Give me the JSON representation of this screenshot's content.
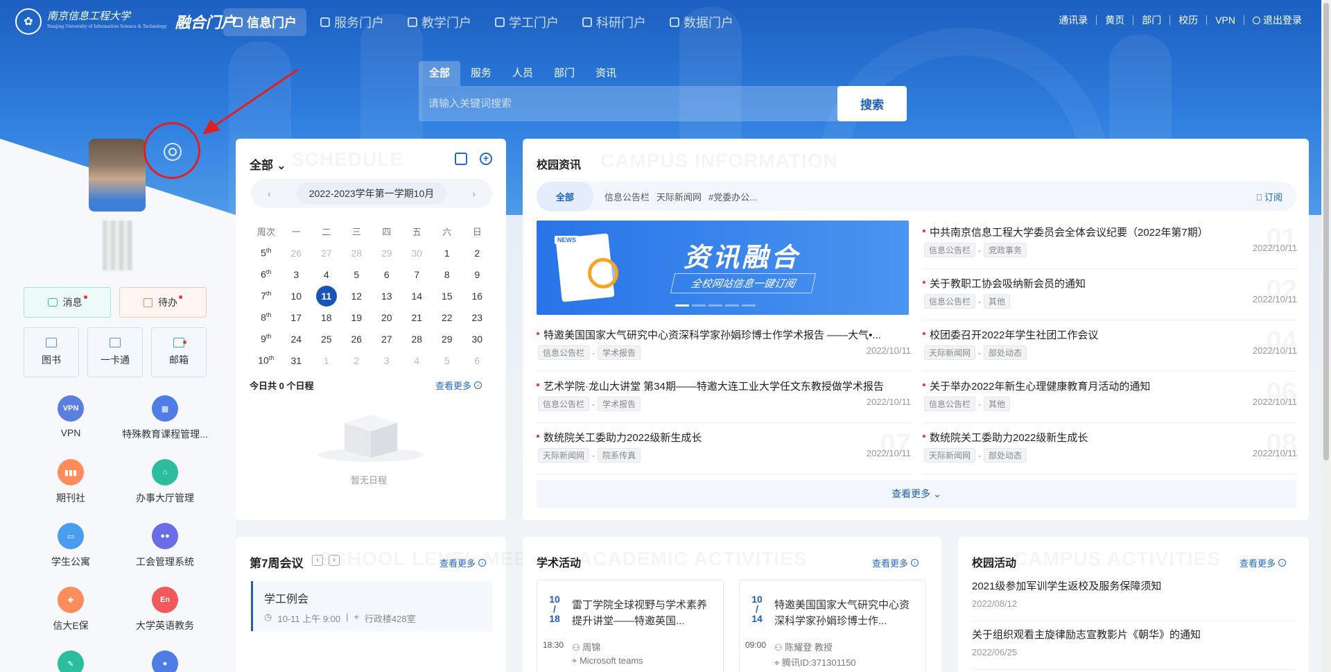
{
  "logo": {
    "school": "南京信息工程大学",
    "school_en": "Nanjing University of Information Science & Technology",
    "portal": "融合门户"
  },
  "nav": {
    "tabs": [
      "信息门户",
      "服务门户",
      "教学门户",
      "学工门户",
      "科研门户",
      "数据门户"
    ],
    "active": 0
  },
  "top_links": [
    "通讯录",
    "黄页",
    "部门",
    "校历",
    "VPN",
    "退出登录"
  ],
  "search": {
    "tabs": [
      "全部",
      "服务",
      "人员",
      "部门",
      "资讯"
    ],
    "placeholder": "请输入关键词搜索",
    "button": "搜索"
  },
  "quick": {
    "message": "消息",
    "todo": "待办",
    "library": "图书",
    "card": "一卡通",
    "mail": "邮箱"
  },
  "apps": [
    {
      "label": "VPN",
      "icon": "vpn-icon",
      "color": "#5b7fe0"
    },
    {
      "label": "特殊教育课程管理...",
      "icon": "course-icon",
      "color": "#4f7de6"
    },
    {
      "label": "期刊社",
      "icon": "books-icon",
      "color": "#ff8d5c"
    },
    {
      "label": "办事大厅管理",
      "icon": "hall-icon",
      "color": "#2bbd9e"
    },
    {
      "label": "学生公寓",
      "icon": "bed-icon",
      "color": "#4a9cf0"
    },
    {
      "label": "工会管理系统",
      "icon": "people-icon",
      "color": "#6a6ee6"
    },
    {
      "label": "信大E保",
      "icon": "bag-icon",
      "color": "#ff8d5c"
    },
    {
      "label": "大学英语教务",
      "icon": "en-icon",
      "color": "#f05a5a"
    }
  ],
  "schedule": {
    "filter": "全部",
    "watermark": "SCHEDULE",
    "month": "2022-2023学年第一学期10月",
    "weekdays": [
      "周次",
      "一",
      "二",
      "三",
      "四",
      "五",
      "六",
      "日"
    ],
    "weeks": [
      {
        "wk": "5",
        "sup": "th",
        "days": [
          [
            "26",
            1
          ],
          [
            "27",
            1
          ],
          [
            "28",
            1
          ],
          [
            "29",
            1
          ],
          [
            "30",
            1
          ],
          [
            "1",
            0
          ],
          [
            "2",
            0
          ]
        ]
      },
      {
        "wk": "6",
        "sup": "th",
        "days": [
          [
            "3",
            0
          ],
          [
            "4",
            0
          ],
          [
            "5",
            0
          ],
          [
            "6",
            0
          ],
          [
            "7",
            0
          ],
          [
            "8",
            0
          ],
          [
            "9",
            0
          ]
        ]
      },
      {
        "wk": "7",
        "sup": "th",
        "days": [
          [
            "10",
            0
          ],
          [
            "11",
            2
          ],
          [
            "12",
            0
          ],
          [
            "13",
            0
          ],
          [
            "14",
            0
          ],
          [
            "15",
            0
          ],
          [
            "16",
            0
          ]
        ]
      },
      {
        "wk": "8",
        "sup": "th",
        "days": [
          [
            "17",
            0
          ],
          [
            "18",
            0
          ],
          [
            "19",
            0
          ],
          [
            "20",
            0
          ],
          [
            "21",
            0
          ],
          [
            "22",
            0
          ],
          [
            "23",
            0
          ]
        ]
      },
      {
        "wk": "9",
        "sup": "th",
        "days": [
          [
            "24",
            0
          ],
          [
            "25",
            0
          ],
          [
            "26",
            0
          ],
          [
            "27",
            0
          ],
          [
            "28",
            0
          ],
          [
            "29",
            0
          ],
          [
            "30",
            0
          ]
        ]
      },
      {
        "wk": "10",
        "sup": "th",
        "days": [
          [
            "31",
            0
          ],
          [
            "1",
            1
          ],
          [
            "2",
            1
          ],
          [
            "3",
            1
          ],
          [
            "4",
            1
          ],
          [
            "5",
            1
          ],
          [
            "6",
            1
          ]
        ]
      }
    ],
    "summary": "今日共 0 个日程",
    "more": "查看更多",
    "empty": "暂无日程"
  },
  "news": {
    "title": "校园资讯",
    "watermark": "CAMPUS INFORMATION",
    "tabs": [
      "全部",
      "信息公告栏",
      "天际新闻网",
      "#党委办公..."
    ],
    "subscribe": "订阅",
    "banner": {
      "title": "资讯融合",
      "subtitle": "全校网站信息一键订阅",
      "tag": "NEWS"
    },
    "left": [
      {
        "title": "特邀美国国家大气研究中心资深科学家孙娟珍博士作学术报告 ——大气•...",
        "src": "信息公告栏",
        "cat": "学术报告",
        "date": "2022/10/11"
      },
      {
        "title": "艺术学院·龙山大讲堂 第34期——特邀大连工业大学任文东教授做学术报告",
        "src": "信息公告栏",
        "cat": "学术报告",
        "date": "2022/10/11"
      },
      {
        "title": "数统院关工委助力2022级新生成长",
        "src": "天际新闻网",
        "cat": "院系传真",
        "date": "2022/10/11",
        "num": "07"
      }
    ],
    "right": [
      {
        "title": "中共南京信息工程大学委员会全体会议纪要（2022年第7期）",
        "src": "信息公告栏",
        "cat": "党政事务",
        "date": "2022/10/11",
        "num": "01"
      },
      {
        "title": "关于教职工协会吸纳新会员的通知",
        "src": "信息公告栏",
        "cat": "其他",
        "date": "2022/10/11",
        "num": "02"
      },
      {
        "title": "校团委召开2022年学生社团工作会议",
        "src": "天际新闻网",
        "cat": "部处动态",
        "date": "2022/10/11",
        "num": "04"
      },
      {
        "title": "关于举办2022年新生心理健康教育月活动的通知",
        "src": "信息公告栏",
        "cat": "其他",
        "date": "2022/10/11",
        "num": "06"
      },
      {
        "title": "数统院关工委助力2022级新生成长",
        "src": "天际新闻网",
        "cat": "部处动态",
        "date": "2022/10/11",
        "num": "08"
      }
    ],
    "more": "查看更多"
  },
  "meeting": {
    "title": "第7周会议",
    "watermark": "SCHOOL LEVEL MEETING",
    "more": "查看更多",
    "item": {
      "title": "学工例会",
      "time": "10-11 上午 9:00",
      "place": "行政楼428室"
    }
  },
  "academic": {
    "title": "学术活动",
    "watermark": "ACADEMIC ACTIVITIES",
    "more": "查看更多",
    "items": [
      {
        "month": "10",
        "day": "18",
        "time": "18:30",
        "title": "雷丁学院全球视野与学术素养提升讲堂——特邀英国...",
        "speaker": "周锦",
        "location": "Microsoft teams"
      },
      {
        "month": "10",
        "day": "14",
        "time": "09:00",
        "title": "特邀美国国家大气研究中心资深科学家孙娟珍博士作...",
        "speaker": "陈耀登 教授",
        "location": "腾讯ID:371301150"
      }
    ]
  },
  "campus": {
    "title": "校园活动",
    "watermark": "CAMPUS ACTIVITIES",
    "more": "查看更多",
    "items": [
      {
        "title": "2021级参加军训学生返校及服务保障须知",
        "date": "2022/08/12"
      },
      {
        "title": "关于组织观看主旋律励志宣教影片《朝华》的通知",
        "date": "2022/06/25"
      }
    ]
  }
}
